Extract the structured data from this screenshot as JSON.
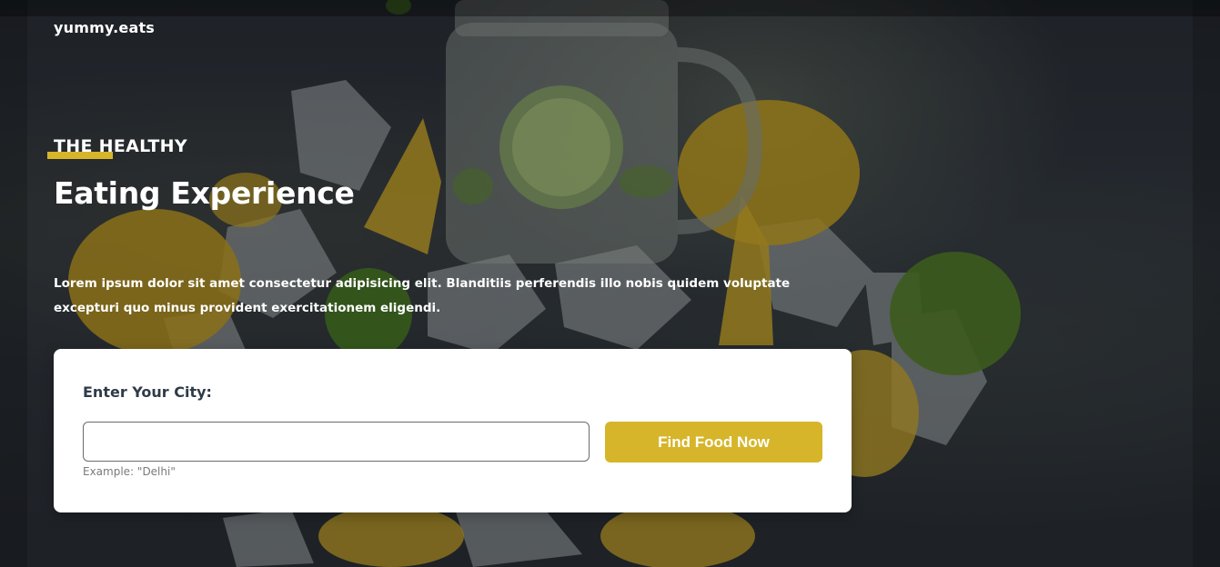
{
  "brand": {
    "name": "yummy.eats"
  },
  "hero": {
    "eyebrow": "THE HEALTHY",
    "headline": "Eating Experience",
    "description": "Lorem ipsum dolor sit amet consectetur adipisicing elit. Blanditiis perferendis illo nobis quidem voluptate excepturi quo minus provident exercitationem eligendi.",
    "background_image": "lemonade-jar-lemons-limes-ice"
  },
  "search": {
    "label": "Enter Your City:",
    "input_value": "",
    "hint": "Example: \"Delhi\"",
    "button_label": "Find Food Now"
  },
  "colors": {
    "accent": "#d6b52a",
    "label_text": "#2f3b48",
    "card_bg": "#ffffff"
  }
}
